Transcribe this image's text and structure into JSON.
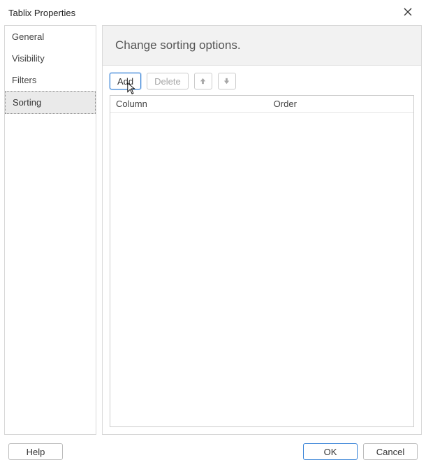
{
  "title": "Tablix Properties",
  "sidebar": {
    "items": [
      {
        "label": "General"
      },
      {
        "label": "Visibility"
      },
      {
        "label": "Filters"
      },
      {
        "label": "Sorting",
        "selected": true
      }
    ]
  },
  "panel": {
    "heading": "Change sorting options."
  },
  "toolbar": {
    "add_label": "Add",
    "delete_label": "Delete"
  },
  "grid": {
    "columns": [
      "Column",
      "Order"
    ],
    "rows": []
  },
  "footer": {
    "help_label": "Help",
    "ok_label": "OK",
    "cancel_label": "Cancel"
  }
}
